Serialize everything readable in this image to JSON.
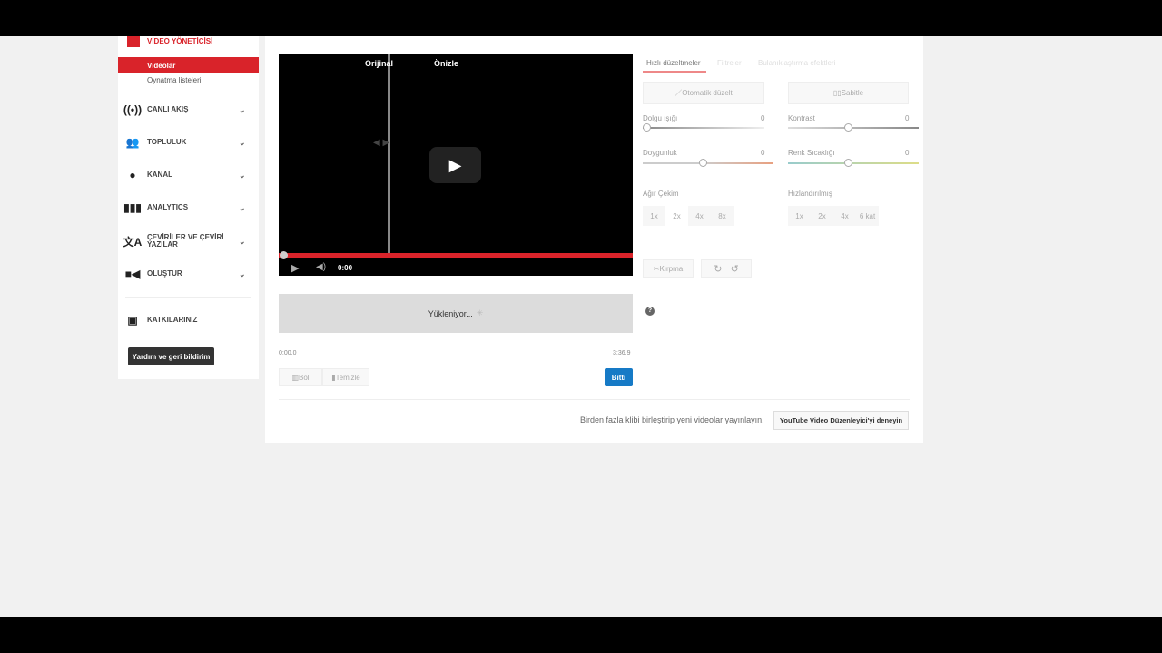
{
  "sidebar": {
    "manager": "VİDEO YÖNETİCİSİ",
    "videos": "Videolar",
    "playlists": "Oynatma listeleri",
    "items": [
      {
        "label": "CANLI AKIŞ",
        "icon": "live-icon"
      },
      {
        "label": "TOPLULUK",
        "icon": "community-icon"
      },
      {
        "label": "KANAL",
        "icon": "channel-icon"
      },
      {
        "label": "ANALYTICS",
        "icon": "analytics-icon"
      },
      {
        "label": "ÇEVİRİLER VE ÇEVİRİ YAZILAR",
        "icon": "translate-icon"
      },
      {
        "label": "OLUŞTUR",
        "icon": "camera-icon"
      }
    ],
    "contributions": "KATKILARINIZ",
    "help": "Yardım ve geri bildirim"
  },
  "video": {
    "original": "Orijinal",
    "preview": "Önizle",
    "time": "0:00"
  },
  "timeline": {
    "loading": "Yükleniyor...",
    "start": "0:00.0",
    "end": "3:36.9",
    "split": "Böl",
    "clear": "Temizle",
    "done": "Bitti"
  },
  "edits": {
    "tabs": [
      "Hızlı düzeltmeler",
      "Filtreler",
      "Bulanıklaştırma efektleri"
    ],
    "auto_fix": "Otomatik düzelt",
    "stabilize": "Sabitle",
    "fill_light": {
      "label": "Dolgu ışığı",
      "value": "0"
    },
    "contrast": {
      "label": "Kontrast",
      "value": "0"
    },
    "saturation": {
      "label": "Doygunluk",
      "value": "0"
    },
    "temperature": {
      "label": "Renk Sıcaklığı",
      "value": "0"
    },
    "slow_motion": "Ağır Çekim",
    "slow_speeds": [
      "1x",
      "2x",
      "4x",
      "8x"
    ],
    "timelapse": "Hızlandırılmış",
    "fast_speeds": [
      "1x",
      "2x",
      "4x",
      "6 kat"
    ],
    "trim": "Kırpma"
  },
  "footer": {
    "text": "Birden fazla klibi birleştirip yeni videolar yayınlayın.",
    "button": "YouTube Video Düzenleyici'yi deneyin"
  },
  "colors": {
    "accent": "#d9232a",
    "primary": "#167ac6"
  }
}
